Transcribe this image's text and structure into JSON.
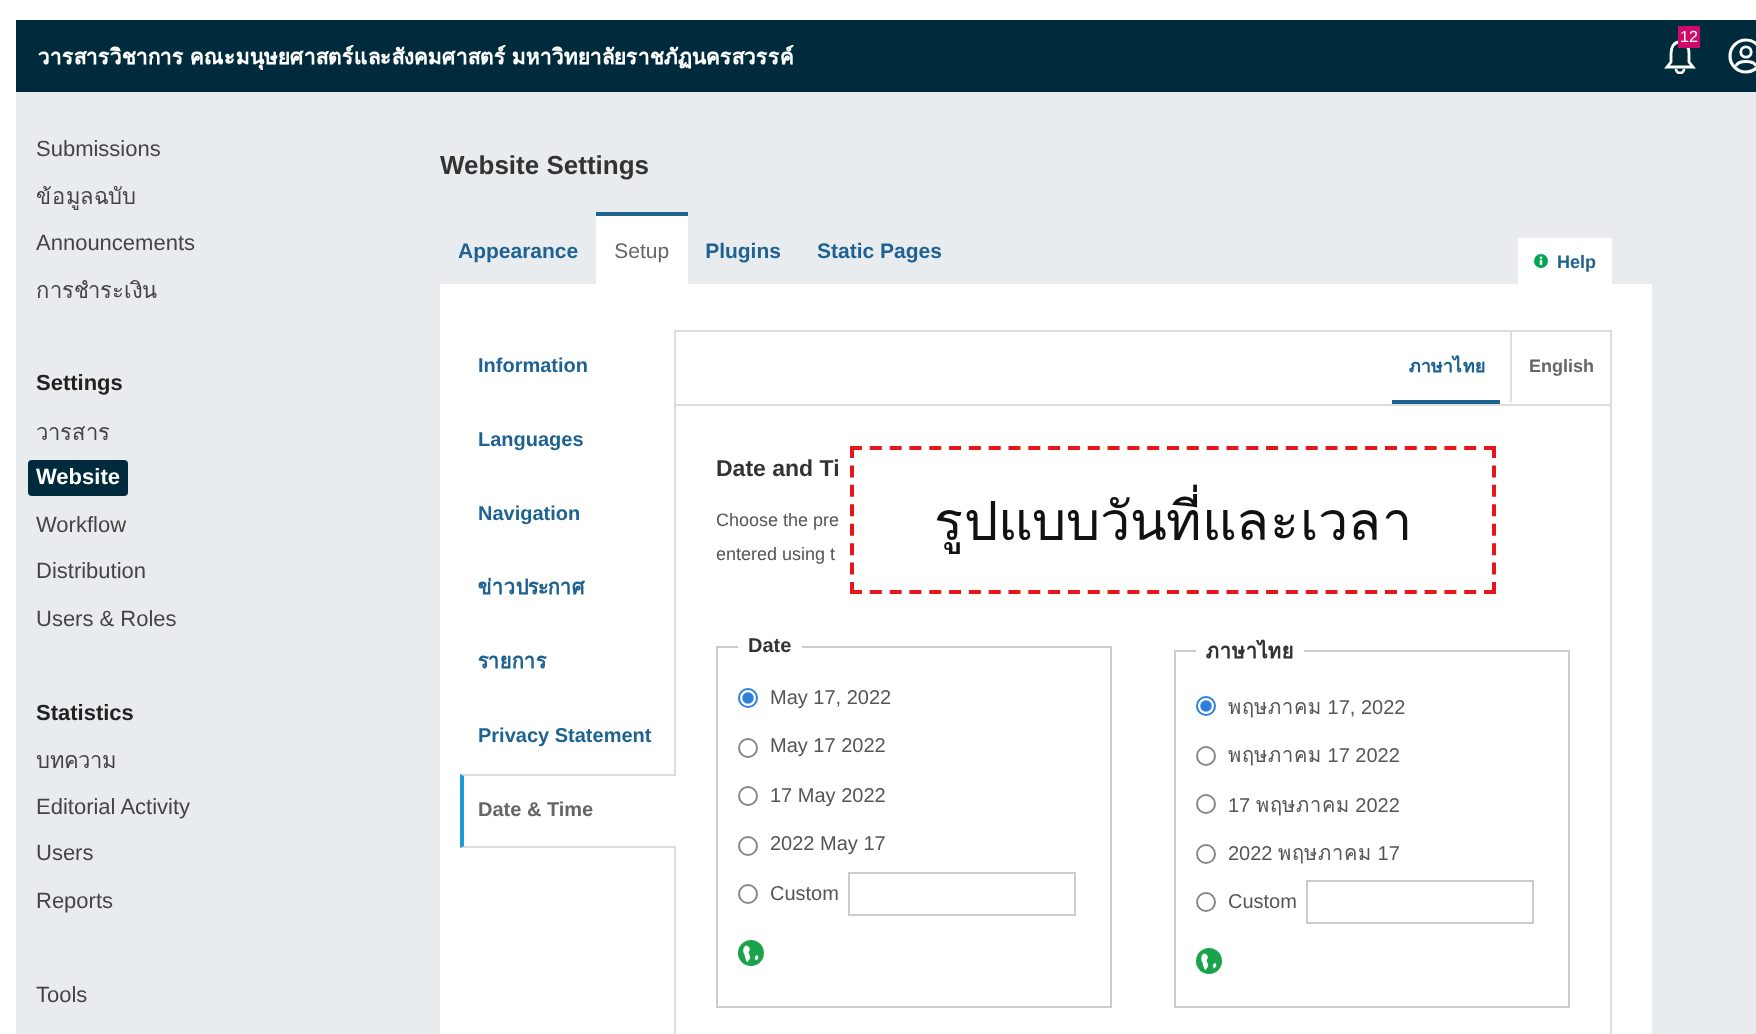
{
  "header": {
    "title": "วารสารวิชาการ คณะมนุษยศาสตร์และสังคมศาสตร์ มหาวิทยาลัยราชภัฏนครสวรรค์",
    "notification_count": "12"
  },
  "sidebar": [
    {
      "items": [
        {
          "label": "Submissions",
          "selected": false
        },
        {
          "label": "ข้อมูลฉบับ",
          "selected": false
        },
        {
          "label": "Announcements",
          "selected": false
        },
        {
          "label": "การชำระเงิน",
          "selected": false
        }
      ]
    },
    {
      "heading": "Settings",
      "items": [
        {
          "label": "วารสาร",
          "selected": false
        },
        {
          "label": "Website",
          "selected": true
        },
        {
          "label": "Workflow",
          "selected": false
        },
        {
          "label": "Distribution",
          "selected": false
        },
        {
          "label": "Users & Roles",
          "selected": false
        }
      ]
    },
    {
      "heading": "Statistics",
      "items": [
        {
          "label": "บทความ",
          "selected": false
        },
        {
          "label": "Editorial Activity",
          "selected": false
        },
        {
          "label": "Users",
          "selected": false
        },
        {
          "label": "Reports",
          "selected": false
        }
      ]
    },
    {
      "items": [
        {
          "label": "Tools",
          "selected": false
        }
      ]
    }
  ],
  "page_title": "Website Settings",
  "tabs": [
    {
      "label": "Appearance",
      "selected": false
    },
    {
      "label": "Setup",
      "selected": true
    },
    {
      "label": "Plugins",
      "selected": false
    },
    {
      "label": "Static Pages",
      "selected": false
    }
  ],
  "help_button": "Help",
  "setup_nav": [
    {
      "label": "Information",
      "selected": false
    },
    {
      "label": "Languages",
      "selected": false
    },
    {
      "label": "Navigation",
      "selected": false
    },
    {
      "label": "ข่าวประกาศ",
      "selected": false
    },
    {
      "label": "รายการ",
      "selected": false
    },
    {
      "label": "Privacy Statement",
      "selected": false
    },
    {
      "label": "Date & Time",
      "selected": true
    }
  ],
  "locale_tabs": [
    {
      "label": "ภาษาไทย",
      "selected": true
    },
    {
      "label": "English",
      "selected": false
    }
  ],
  "section": {
    "heading": "Date and Ti",
    "description_lines": [
      "Choose the pre",
      "entered using t"
    ]
  },
  "annotation": "รูปแบบวันที่และเวลา",
  "fieldsets": [
    {
      "legend": "Date",
      "options": [
        {
          "kind": "radio",
          "label": "May 17, 2022",
          "selected": true
        },
        {
          "kind": "radio",
          "label": "May 17 2022",
          "selected": false
        },
        {
          "kind": "radio",
          "label": "17 May 2022",
          "selected": false
        },
        {
          "kind": "radio",
          "label": "2022 May 17",
          "selected": false
        },
        {
          "kind": "custom",
          "label": "Custom",
          "selected": false
        }
      ]
    },
    {
      "legend": "ภาษาไทย",
      "options": [
        {
          "kind": "radio",
          "label": "พฤษภาคม 17, 2022",
          "selected": true
        },
        {
          "kind": "radio",
          "label": "พฤษภาคม 17 2022",
          "selected": false
        },
        {
          "kind": "radio",
          "label": "17 พฤษภาคม 2022",
          "selected": false
        },
        {
          "kind": "radio",
          "label": "2022 พฤษภาคม 17",
          "selected": false
        },
        {
          "kind": "custom",
          "label": "Custom",
          "selected": false
        }
      ]
    }
  ]
}
